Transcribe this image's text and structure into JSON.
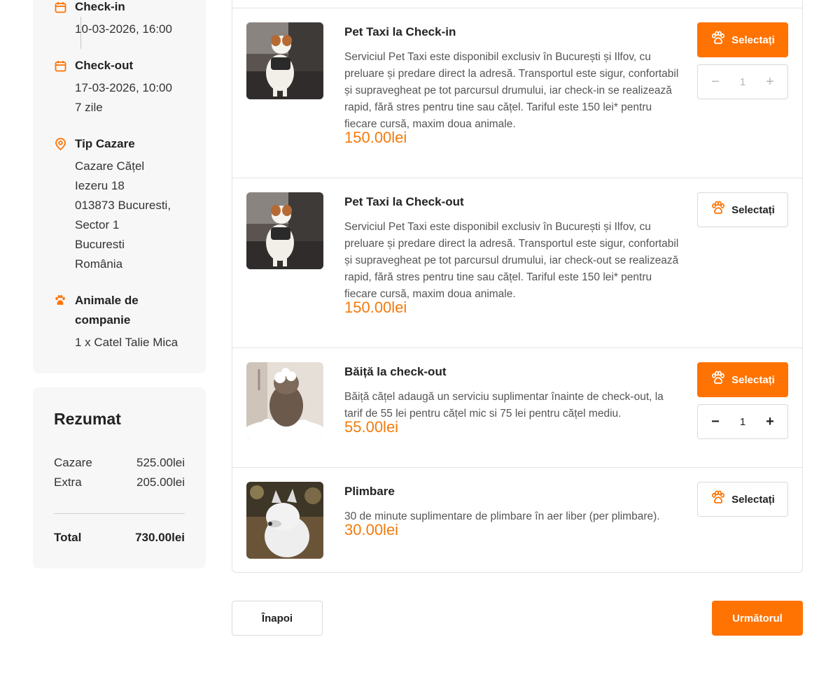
{
  "colors": {
    "accent": "#ff7303",
    "price": "#f47a0c",
    "card_bg": "#f7f7f7"
  },
  "booking": {
    "checkin": {
      "title": "Check-in",
      "value": "10-03-2026, 16:00",
      "icon": "calendar-icon"
    },
    "checkout": {
      "title": "Check-out",
      "value": "17-03-2026, 10:00",
      "duration": "7 zile",
      "icon": "calendar-icon"
    },
    "accommodation": {
      "title": "Tip Cazare",
      "icon": "location-pin-icon",
      "lines": [
        "Cazare Cățel",
        "Iezeru 18",
        "013873 Bucuresti,",
        "Sector 1",
        "Bucuresti",
        "România"
      ]
    },
    "pets": {
      "title_line1": "Animale de",
      "title_line2": "companie",
      "value": "1 x Catel Talie Mica",
      "icon": "paw-icon"
    }
  },
  "summary": {
    "title": "Rezumat",
    "rows": [
      {
        "label": "Cazare",
        "value": "525.00lei"
      },
      {
        "label": "Extra",
        "value": "205.00lei"
      }
    ],
    "total": {
      "label": "Total",
      "value": "730.00lei"
    }
  },
  "services": [
    {
      "title": "Pet Taxi la Check-in",
      "description": "Serviciul Pet Taxi este disponibil exclusiv în București și Ilfov, cu preluare și predare direct la adresă. Transportul este sigur, confortabil și supravegheat pe tot parcursul drumului, iar check-in se realizează rapid, fără stres pentru tine sau cățel. Tariful este 150 lei* pentru fiecare cursă, maxim doua animale.",
      "price": "150.00lei",
      "button_label": "Selectați",
      "selected": true,
      "quantity": "1",
      "image": "dog-in-car-photo"
    },
    {
      "title": "Pet Taxi la Check-out",
      "description": "Serviciul Pet Taxi este disponibil exclusiv în București și Ilfov, cu preluare și predare direct la adresă. Transportul este sigur, confortabil și supravegheat pe tot parcursul drumului, iar check-out se realizează rapid, fără stres pentru tine sau cățel. Tariful este 150 lei* pentru fiecare cursă, maxim doua animale.",
      "price": "150.00lei",
      "button_label": "Selectați",
      "selected": false,
      "image": "dog-in-car-photo"
    },
    {
      "title": "Băiță la check-out",
      "description": "Băiță cățel adaugă un serviciu suplimentar înainte de check-out, la tarif de 55 lei pentru cățel mic si 75 lei pentru cățel mediu.",
      "price": "55.00lei",
      "button_label": "Selectați",
      "selected": true,
      "quantity": "1",
      "image": "dog-bath-photo"
    },
    {
      "title": "Plimbare",
      "description": "30 de minute suplimentare de plimbare în aer liber (per plimbare).",
      "price": "30.00lei",
      "button_label": "Selectați",
      "selected": false,
      "image": "husky-photo"
    }
  ],
  "stepper": {
    "minus": "−",
    "plus": "+"
  },
  "nav": {
    "back_label": "Înapoi",
    "next_label": "Următorul"
  }
}
